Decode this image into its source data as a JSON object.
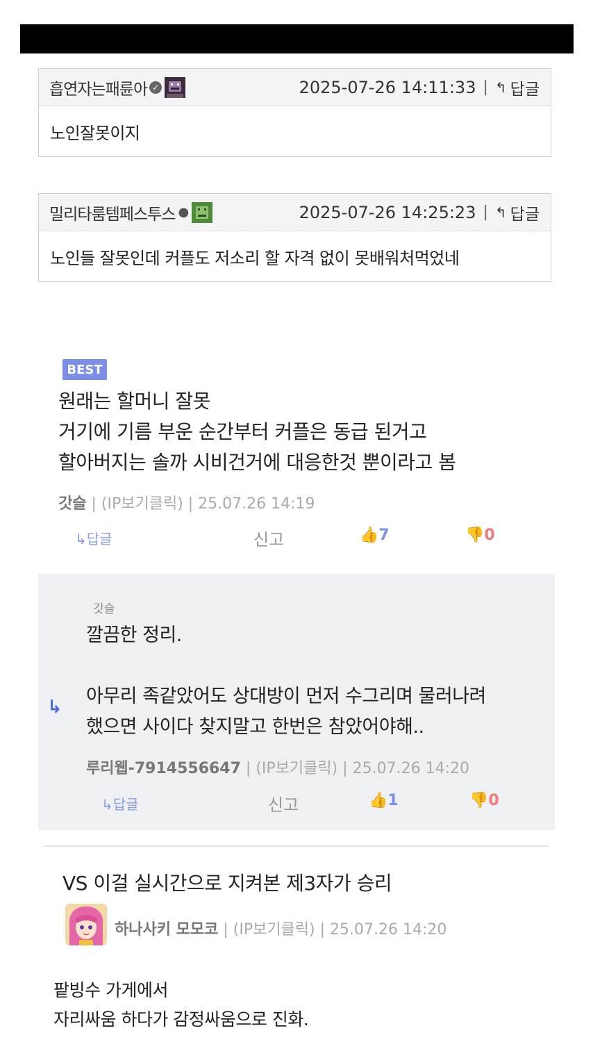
{
  "comments": [
    {
      "nickname": "흡연자는패륜아",
      "date": "2025-07-26 14:11:33",
      "reply_label": "답글",
      "body": "노인잘못이지"
    },
    {
      "nickname": "밀리타룸템페스투스",
      "date": "2025-07-26 14:25:23",
      "reply_label": "답글",
      "body": "노인들 잘못인데 커플도 저소리 할 자격 없이 못배워처먹었네"
    }
  ],
  "best": {
    "badge": "BEST",
    "lines": [
      "원래는 할머니 잘못",
      "거기에 기름 부운 순간부터 커플은 동급 된거고",
      "할아버지는 솔까 시비건거에 대응한것 뿐이라고 봄"
    ],
    "author": "갓슬",
    "ip_label": "(IP보기클릭)",
    "date": "25.07.26 14:19",
    "reply_label": "답글",
    "report_label": "신고",
    "upvotes": "7",
    "downvotes": "0"
  },
  "nested_reply": {
    "reply_to": "갓슬",
    "lines": [
      "깔끔한 정리.",
      "",
      "아무리 족같았어도 상대방이 먼저 수그리며 물러나려",
      "했으면 사이다 찾지말고 한번은 참았어야해.."
    ],
    "author": "루리웹-7914556647",
    "ip_label": "(IP보기클릭)",
    "date": "25.07.26 14:20",
    "reply_label": "답글",
    "report_label": "신고",
    "upvotes": "1",
    "downvotes": "0"
  },
  "vs_comment": {
    "title": "VS 이걸 실시간으로 지켜본 제3자가 승리",
    "author": "하나사키 모모코",
    "ip_label": "(IP보기클릭)",
    "date": "25.07.26 14:20"
  },
  "bottom_text": [
    "팥빙수 가게에서",
    "자리싸움 하다가 감정싸움으로 진화."
  ],
  "colors": {
    "accent": "#7c8ee8",
    "downvote": "#ee7a7a",
    "reply_bg": "#eef0f4"
  },
  "icons": [
    "verified-icon",
    "pixel-avatar-icon",
    "person-icon",
    "reply-arrow-icon",
    "thumbs-up-icon",
    "thumbs-down-icon",
    "nested-reply-arrow-icon"
  ]
}
